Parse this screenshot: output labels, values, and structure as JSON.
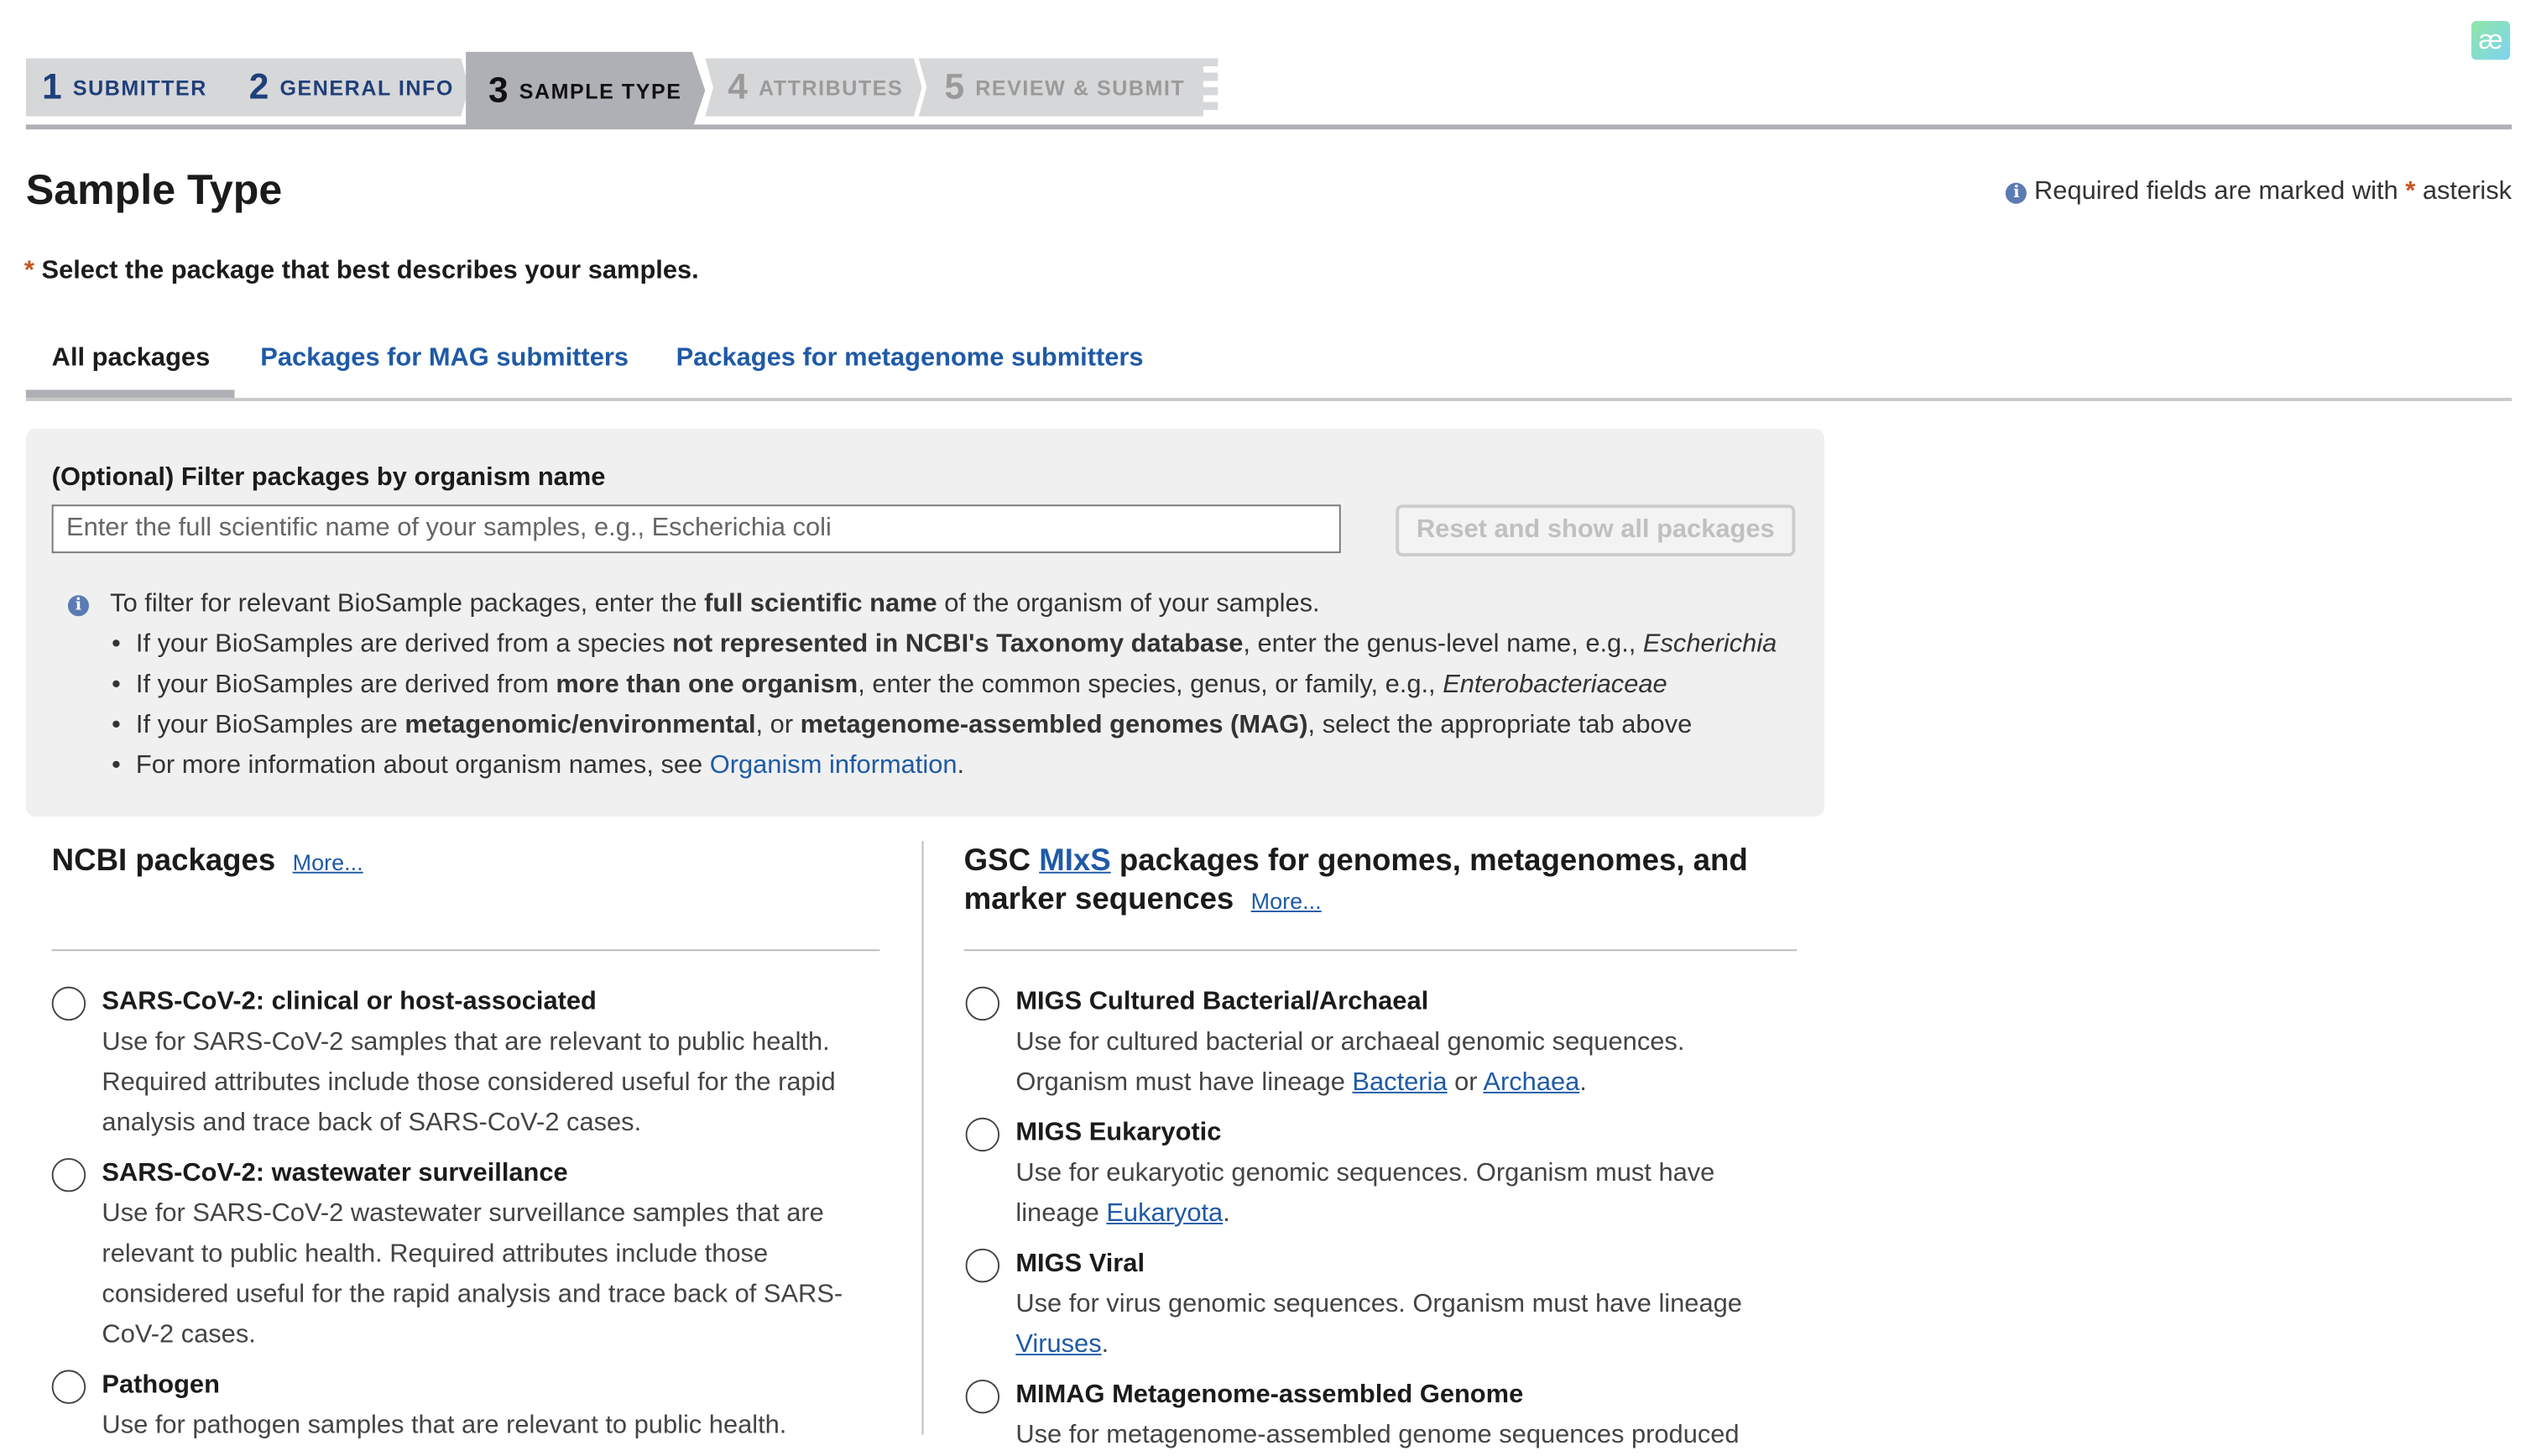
{
  "stepper": [
    {
      "num": "1",
      "label": "SUBMITTER",
      "state": "done"
    },
    {
      "num": "2",
      "label": "GENERAL INFO",
      "state": "done"
    },
    {
      "num": "3",
      "label": "SAMPLE TYPE",
      "state": "active"
    },
    {
      "num": "4",
      "label": "ATTRIBUTES",
      "state": "todo"
    },
    {
      "num": "5",
      "label": "REVIEW & SUBMIT",
      "state": "todo"
    }
  ],
  "logo": "æ",
  "title": "Sample Type",
  "required_note": {
    "pre": "Required fields are marked with",
    "star": "*",
    "post": "asterisk"
  },
  "prompt": "Select the package that best describes your samples.",
  "tabs": [
    "All packages",
    "Packages for MAG submitters",
    "Packages for metagenome submitters"
  ],
  "filter": {
    "label": "(Optional) Filter packages by organism name",
    "placeholder": "Enter the full scientific name of your samples, e.g., Escherichia coli",
    "reset": "Reset and show all packages",
    "info": {
      "a": "To filter for relevant BioSample packages, enter the ",
      "b": "full scientific name",
      "c": " of the organism of your samples."
    },
    "b1": {
      "a": "If your BioSamples are derived from a species ",
      "b": "not represented in NCBI's Taxonomy database",
      "c": ", enter the genus-level name, e.g., ",
      "d": "Escherichia"
    },
    "b2": {
      "a": "If your BioSamples are derived from ",
      "b": "more than one organism",
      "c": ", enter the common species, genus, or family, e.g., ",
      "d": "Enterobacteriaceae"
    },
    "b3": {
      "a": "If your BioSamples are ",
      "b": "metagenomic/environmental",
      "c": ", or ",
      "d": "metagenome-assembled genomes (MAG)",
      "e": ", select the appropriate tab above"
    },
    "b4": {
      "a": "For more information about organism names, see ",
      "link": "Organism information",
      "c": "."
    }
  },
  "ncbi": {
    "heading": "NCBI packages",
    "more": "More...",
    "items": [
      {
        "title": "SARS-CoV-2: clinical or host-associated",
        "l1": "Use for SARS-CoV-2 samples that are relevant to public health.",
        "l2": "Required attributes include those considered useful for the rapid",
        "l3": "analysis and trace back of SARS-CoV-2 cases."
      },
      {
        "title": "SARS-CoV-2: wastewater surveillance",
        "l1": "Use for SARS-CoV-2 wastewater surveillance samples that are",
        "l2": "relevant to public health. Required attributes include those",
        "l3": "considered useful for the rapid analysis and trace back of SARS-",
        "l4": "CoV-2 cases."
      },
      {
        "title": "Pathogen",
        "l1": "Use for pathogen samples that are relevant to public health."
      }
    ]
  },
  "gsc": {
    "h_a": "GSC ",
    "h_link": "MIxS",
    "h_b": " packages for genomes, metagenomes, and",
    "h_c": "marker sequences",
    "more": "More...",
    "items": [
      {
        "title": "MIGS Cultured Bacterial/Archaeal",
        "l1": "Use for cultured bacterial or archaeal genomic sequences.",
        "l2": "Organism must have lineage ",
        "link1": "Bacteria",
        "mid": " or ",
        "link2": "Archaea",
        "end": "."
      },
      {
        "title": "MIGS Eukaryotic",
        "l1": "Use for eukaryotic genomic sequences. Organism must have",
        "l2": "lineage ",
        "link1": "Eukaryota",
        "end": "."
      },
      {
        "title": "MIGS Viral",
        "l1": "Use for virus genomic sequences. Organism must have lineage",
        "link1": "Viruses",
        "end": "."
      },
      {
        "title": "MIMAG Metagenome-assembled Genome",
        "l1": "Use for metagenome-assembled genome sequences produced"
      }
    ]
  }
}
